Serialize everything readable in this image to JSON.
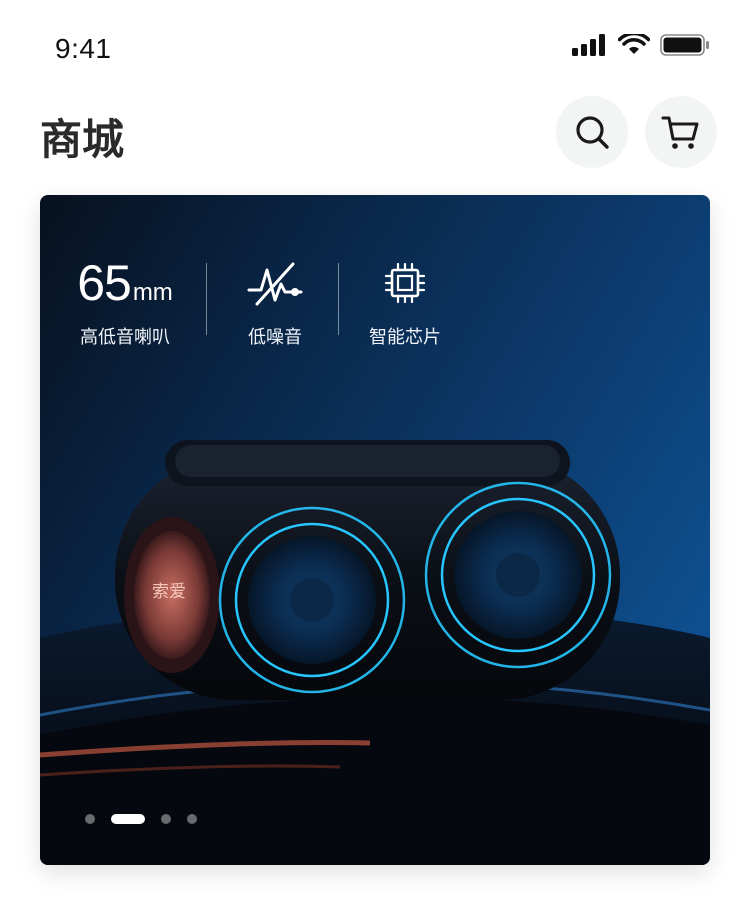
{
  "status_bar": {
    "time": "9:41"
  },
  "header": {
    "title": "商城",
    "search_icon": "search-icon",
    "cart_icon": "cart-icon"
  },
  "banner": {
    "features": [
      {
        "value": "65",
        "unit": "mm",
        "label": "高低音喇叭"
      },
      {
        "icon": "noise-reduction-icon",
        "label": "低噪音"
      },
      {
        "icon": "chip-icon",
        "label": "智能芯片"
      }
    ],
    "product_brand": "索爱",
    "carousel": {
      "total": 4,
      "active_index": 1
    }
  },
  "colors": {
    "banner_dark": "#07111f",
    "banner_blue": "#0e4e8e",
    "accent_cyan": "#27c6ff",
    "accent_copper": "#d9705a",
    "icon_button_bg": "#f3f5f4"
  }
}
